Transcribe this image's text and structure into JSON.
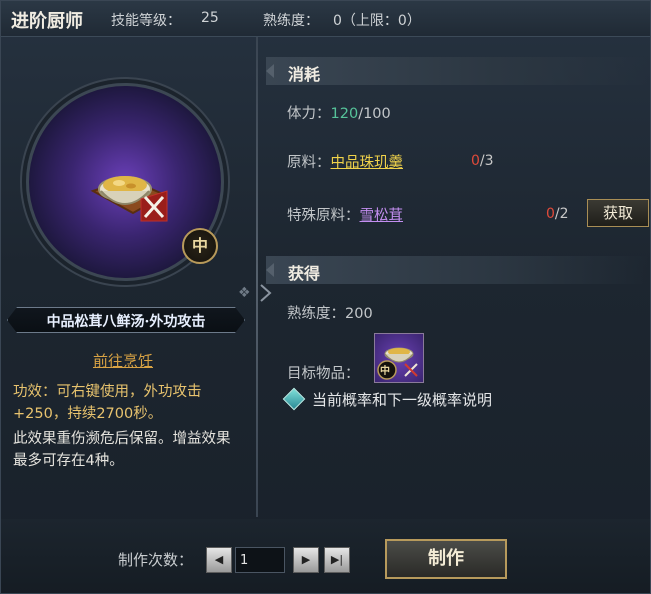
{
  "header": {
    "title": "进阶厨师",
    "skill_level_label": "技能等级：",
    "skill_level_value": "25",
    "proficiency_label": "熟练度：",
    "proficiency_value": "0（上限：0）"
  },
  "dish": {
    "name": "中品松茸八鲜汤·外功攻击",
    "grade": "中",
    "goto_link": "前往烹饪",
    "effect": "功效：可右键使用，外功攻击+250，持续2700秒。",
    "note": "此效果重伤濒危后保留。增益效果最多可存在4种。"
  },
  "consume": {
    "title": "消耗",
    "stamina_label": "体力：",
    "stamina_current": "120",
    "stamina_max": "/100",
    "material_label": "原料：",
    "material_name": "中品珠玑羹",
    "material_have": "0",
    "material_need": "/3",
    "special_label": "特殊原料：",
    "special_name": "雪松茸",
    "special_have": "0",
    "special_need": "/2",
    "get_button": "获取"
  },
  "gain": {
    "title": "获得",
    "proficiency": "熟练度：200",
    "target_label": "目标物品：",
    "target_grade": "中",
    "probability_text": "当前概率和下一级概率说明"
  },
  "footer": {
    "times_label": "制作次数：",
    "quantity": "1",
    "make_button": "制作"
  },
  "colors": {
    "accent_gold": "#d9a344",
    "stamina_green": "#56c39a",
    "shortfall_red": "#e04a3a",
    "rare_purple": "#c38ef0",
    "material_yellow": "#f0d24a"
  }
}
